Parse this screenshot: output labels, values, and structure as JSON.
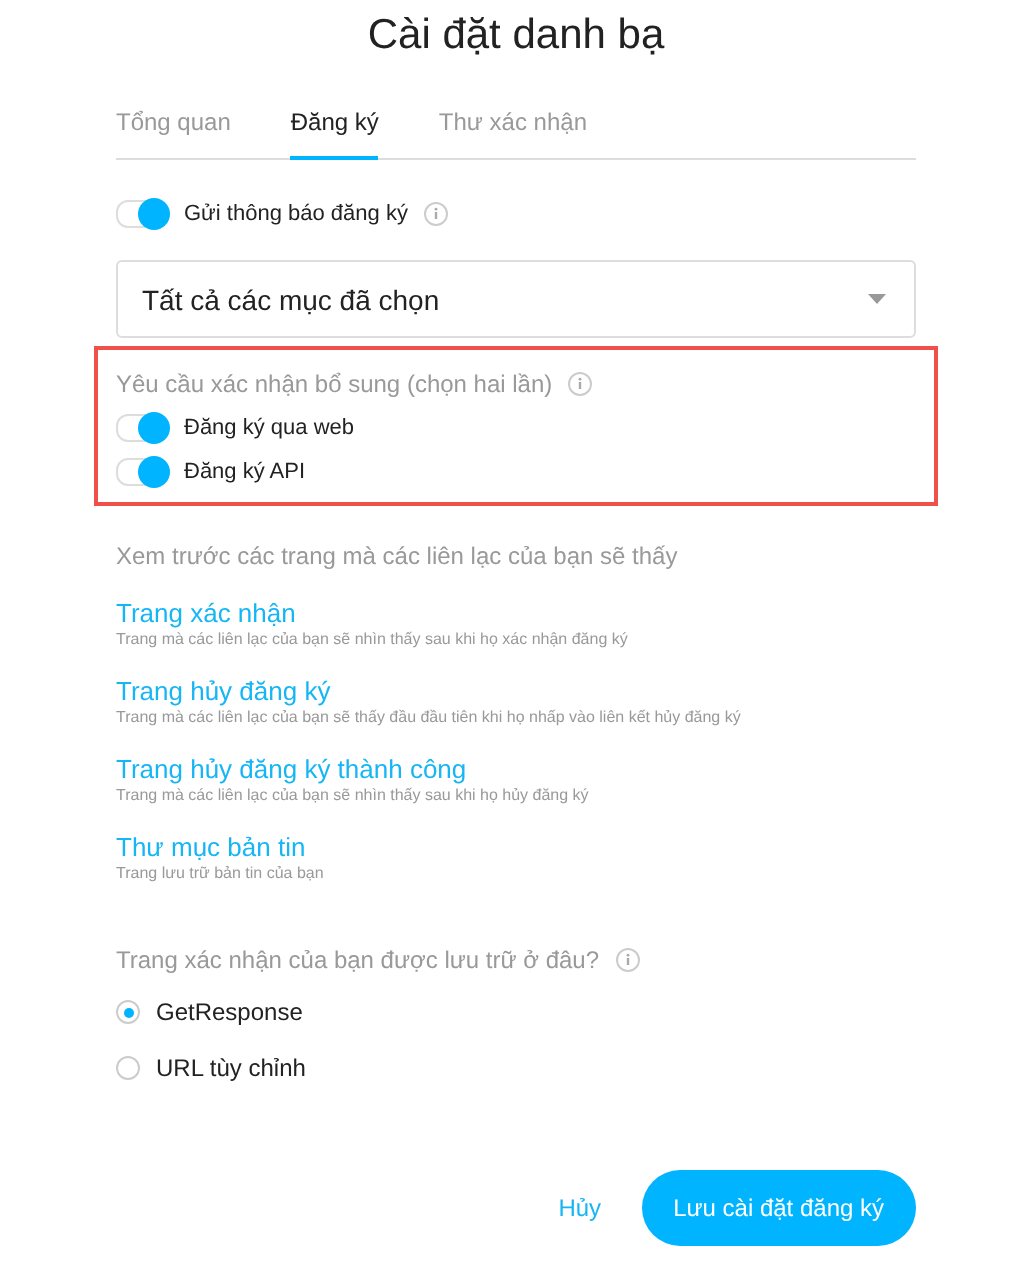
{
  "title": "Cài đặt danh bạ",
  "tabs": [
    {
      "label": "Tổng quan",
      "selected": false
    },
    {
      "label": "Đăng ký",
      "selected": true
    },
    {
      "label": "Thư xác nhận",
      "selected": false
    }
  ],
  "notify_toggle": {
    "label": "Gửi thông báo đăng ký",
    "on": true
  },
  "dropdown": {
    "value": "Tất cả các mục đã chọn"
  },
  "confirmation_section": {
    "heading": "Yêu cầu xác nhận bổ sung (chọn hai lần)",
    "highlighted": true,
    "toggles": [
      {
        "label": "Đăng ký qua web",
        "on": true
      },
      {
        "label": "Đăng ký API",
        "on": true
      }
    ]
  },
  "preview": {
    "heading": "Xem trước các trang mà các liên lạc của bạn sẽ thấy",
    "pages": [
      {
        "title": "Trang xác nhận",
        "description": "Trang mà các liên lạc của bạn sẽ nhìn thấy sau khi họ xác nhận đăng ký"
      },
      {
        "title": "Trang hủy đăng ký",
        "description": "Trang mà các liên lạc của bạn sẽ thấy đầu đầu tiên khi họ nhấp vào liên kết hủy đăng ký"
      },
      {
        "title": "Trang hủy đăng ký thành công",
        "description": "Trang mà các liên lạc của bạn sẽ nhìn thấy sau khi họ hủy đăng ký"
      },
      {
        "title": "Thư mục bản tin",
        "description": "Trang lưu trữ bản tin của bạn"
      }
    ]
  },
  "hosting": {
    "question": "Trang xác nhận của bạn được lưu trữ ở đâu?",
    "options": [
      {
        "label": "GetResponse",
        "selected": true
      },
      {
        "label": "URL tùy chỉnh",
        "selected": false
      }
    ]
  },
  "buttons": {
    "cancel": "Hủy",
    "save": "Lưu cài đặt đăng ký"
  }
}
